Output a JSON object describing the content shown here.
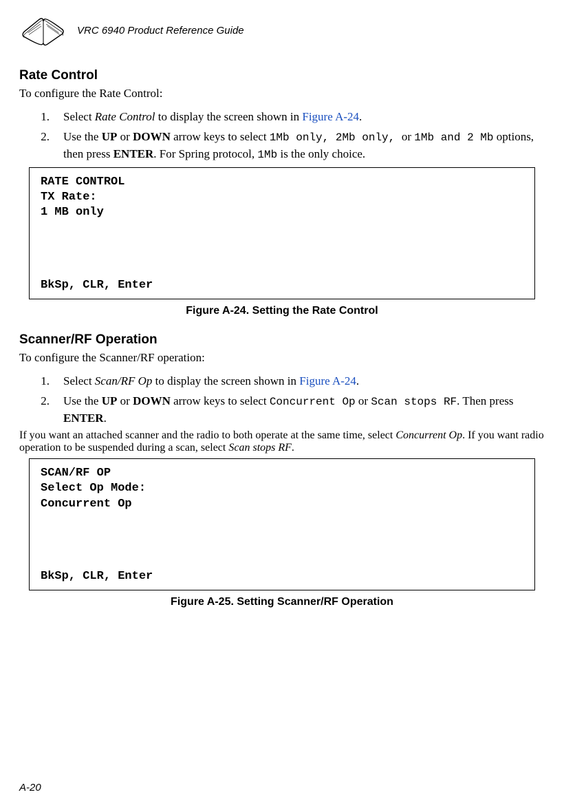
{
  "header": {
    "title": "VRC 6940 Product Reference Guide"
  },
  "section1": {
    "heading": "Rate Control",
    "intro": "To configure the Rate Control:",
    "item1_num": "1.",
    "item1_pre": "Select ",
    "item1_em": "Rate Control",
    "item1_mid": " to display the screen shown in ",
    "item1_link": "Figure A-24",
    "item1_post": ".",
    "item2_num": "2.",
    "item2_a": "Use the ",
    "item2_up": "UP",
    "item2_b": " or ",
    "item2_down": "DOWN",
    "item2_c": " arrow keys to select ",
    "item2_opt1": "1Mb only",
    "item2_sep1": ", ",
    "item2_opt2": "2Mb only",
    "item2_sep2": ", ",
    "item2_or": " or ",
    "item2_opt3": "1Mb and 2 Mb",
    "item2_d": " options, then press ",
    "item2_enter": "ENTER",
    "item2_e": ". For Spring protocol, ",
    "item2_mono": "1Mb",
    "item2_f": " is the only choice.",
    "screen": {
      "line1": "RATE CONTROL",
      "line2": "TX Rate:",
      "line3": "1 MB only",
      "footer": "BkSp, CLR, Enter"
    },
    "caption": "Figure A-24.  Setting the Rate Control"
  },
  "section2": {
    "heading": "Scanner/RF Operation",
    "intro": "To configure the Scanner/RF operation:",
    "item1_num": "1.",
    "item1_pre": "Select ",
    "item1_em": "Scan/RF Op",
    "item1_mid": " to display the screen shown in ",
    "item1_link": "Figure A-24",
    "item1_post": ".",
    "item2_num": "2.",
    "item2_a": "Use the ",
    "item2_up": "UP",
    "item2_b": " or ",
    "item2_down": "DOWN",
    "item2_c": " arrow keys to select ",
    "item2_opt1": "Concurrent Op",
    "item2_or": " or ",
    "item2_opt2": "Scan stops RF",
    "item2_d": ". Then press ",
    "item2_enter": "ENTER",
    "item2_e": ".",
    "item2_note_a": "If you want an attached scanner and the radio to both operate at the same time, select ",
    "item2_note_em1": "Concurrent Op",
    "item2_note_b": ". If you want radio operation to be suspended during a scan, select ",
    "item2_note_em2": "Scan stops RF",
    "item2_note_c": ".",
    "screen": {
      "line1": "SCAN/RF OP",
      "line2": "Select Op Mode:",
      "line3": "Concurrent Op",
      "footer": "BkSp, CLR, Enter"
    },
    "caption": "Figure A-25.  Setting Scanner/RF Operation"
  },
  "page_number": "A-20"
}
